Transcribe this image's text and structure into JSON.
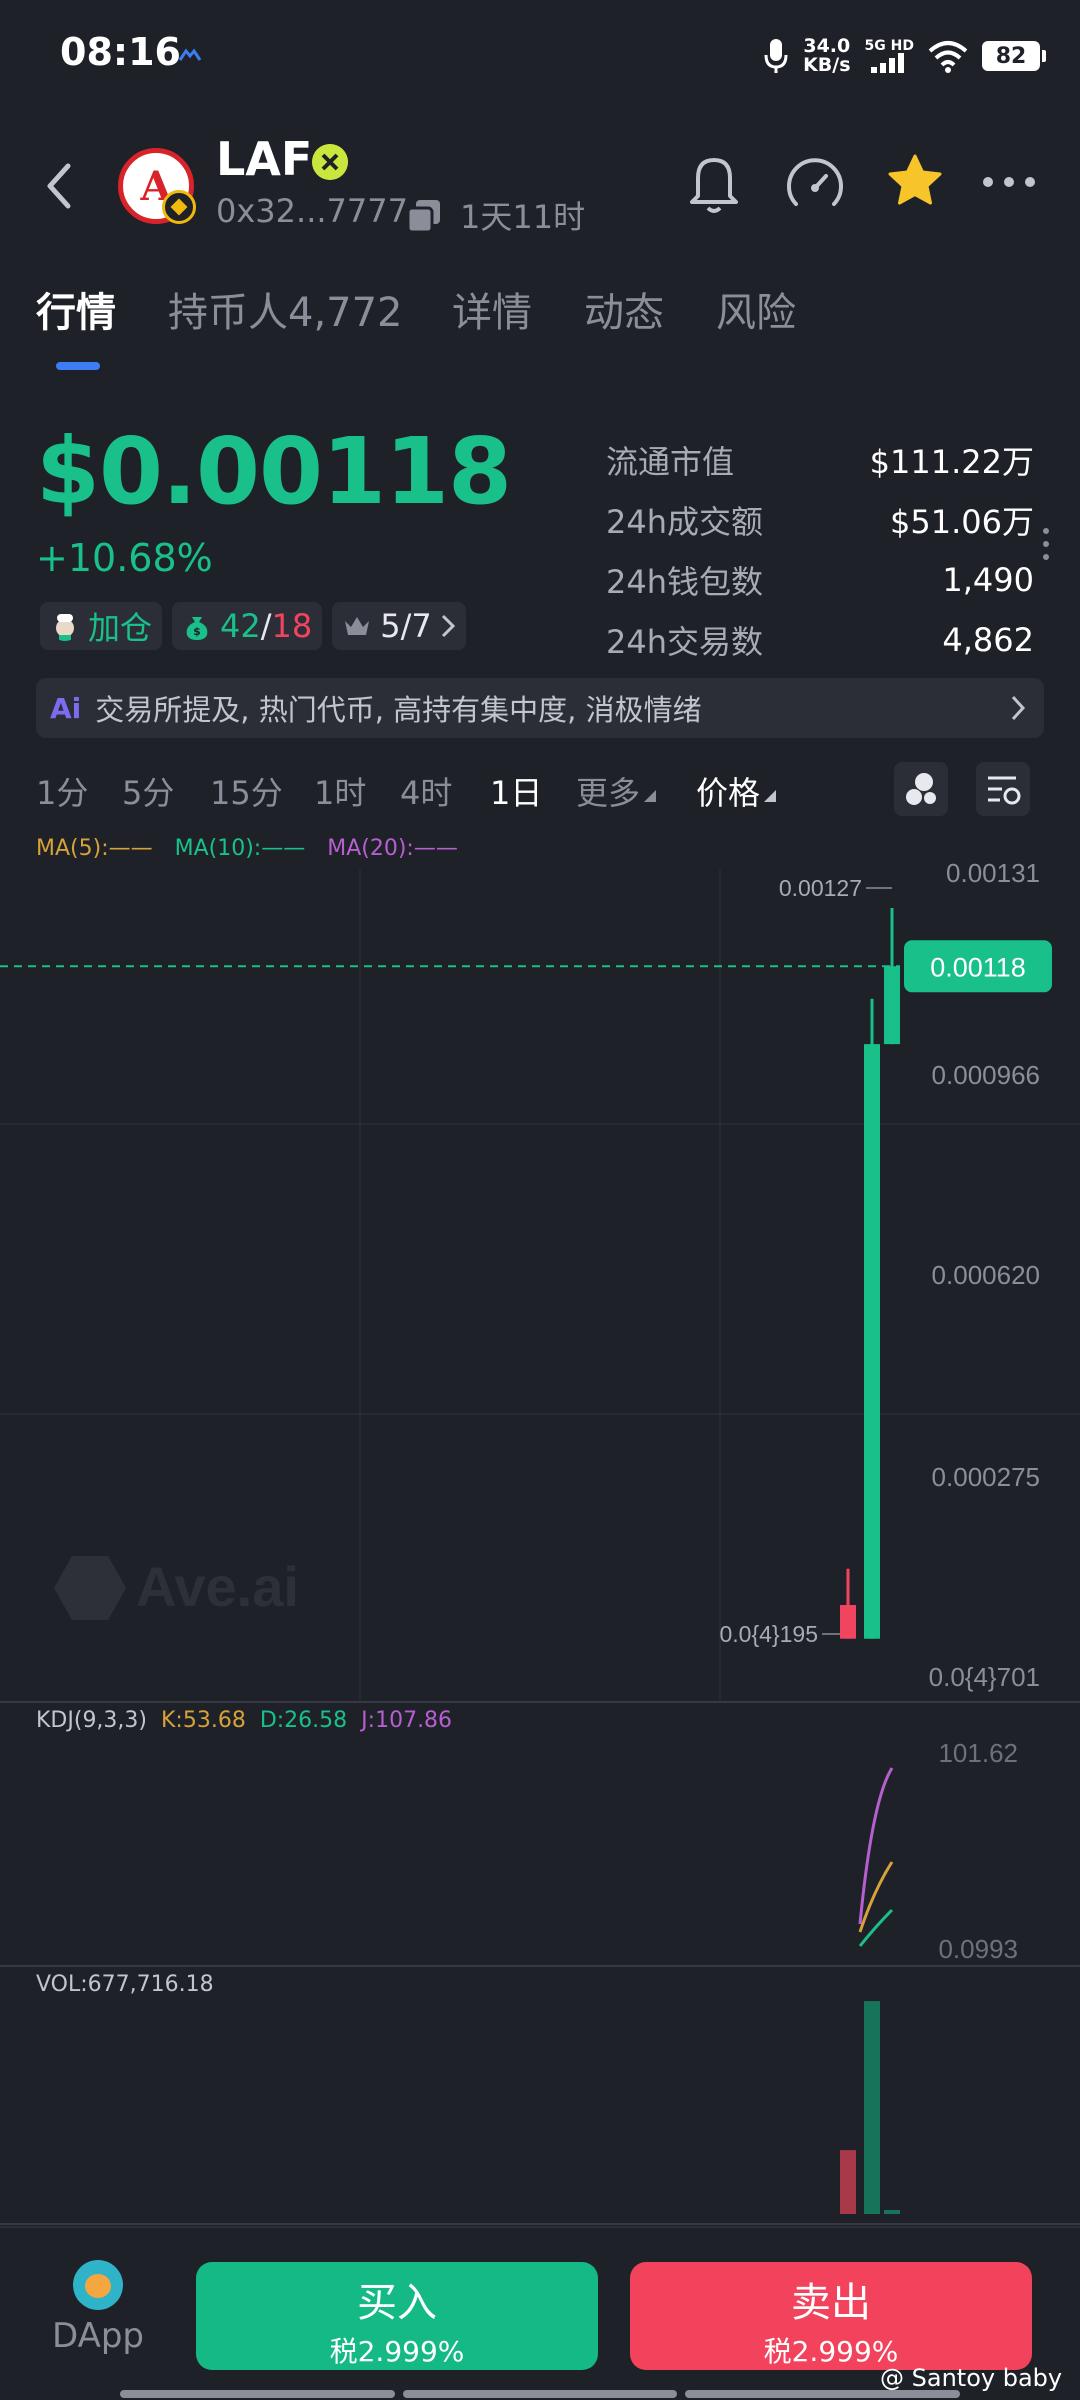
{
  "status_bar": {
    "time": "08:16",
    "net_speed_value": "34.0",
    "net_speed_unit": "KB/s",
    "network_label": "5G HD",
    "battery": "82"
  },
  "header": {
    "token_symbol": "LAF",
    "token_logo_letter": "A",
    "address": "0x32...7777",
    "age": "1天11时"
  },
  "tabs": [
    {
      "label": "行情"
    },
    {
      "label": "持币人4,772"
    },
    {
      "label": "详情"
    },
    {
      "label": "动态"
    },
    {
      "label": "风险"
    }
  ],
  "price": {
    "value": "$0.00118",
    "change": "+10.68%"
  },
  "chips": {
    "add_label": "加仓",
    "holders_green": "42",
    "holders_sep": "/",
    "holders_red": "18",
    "top_value": "5/7"
  },
  "stats": [
    {
      "label": "流通市值",
      "value": "$111.22万"
    },
    {
      "label": "24h成交额",
      "value": "$51.06万"
    },
    {
      "label": "24h钱包数",
      "value": "1,490"
    },
    {
      "label": "24h交易数",
      "value": "4,862"
    }
  ],
  "ai_bar": {
    "icon_text": "Ai",
    "text": "交易所提及, 热门代币, 高持有集中度, 消极情绪"
  },
  "timeframes": [
    {
      "label": "1分"
    },
    {
      "label": "5分"
    },
    {
      "label": "15分"
    },
    {
      "label": "1时"
    },
    {
      "label": "4时"
    },
    {
      "label": "1日"
    },
    {
      "label": "更多"
    },
    {
      "label": "价格"
    }
  ],
  "ma_legend": {
    "ma5": "MA(5):——",
    "ma10": "MA(10):——",
    "ma20": "MA(20):——"
  },
  "chart_data": {
    "type": "candlestick",
    "price_axis_labels": [
      "0.00131",
      "0.000966",
      "0.000620",
      "0.000275",
      "0.0{4}701"
    ],
    "current_price_label": "0.00118",
    "high_label": "0.00127",
    "low_label": "0.0{4}195",
    "candles": [
      {
        "open": 0.000195,
        "close": 0.000143,
        "high": 0.000251,
        "low": 0.000143,
        "direction": "down"
      },
      {
        "open": 0.000143,
        "close": 0.00106,
        "high": 0.00113,
        "low": 0.000143,
        "direction": "up"
      },
      {
        "open": 0.00106,
        "close": 0.00118,
        "high": 0.00127,
        "low": 0.00106,
        "direction": "up"
      }
    ],
    "watermark": "Ave.ai",
    "kdj": {
      "label": "KDJ(9,3,3)",
      "k": "K:53.68",
      "d": "D:26.58",
      "j": "J:107.86",
      "axis_max": "101.62",
      "axis_min": "0.0993"
    },
    "volume": {
      "label": "VOL:677,716.18",
      "bars": [
        {
          "value": 180000,
          "direction": "down"
        },
        {
          "value": 600000,
          "direction": "up"
        },
        {
          "value": 8000,
          "direction": "up"
        }
      ]
    },
    "colors": {
      "up": "#19c08a",
      "down": "#f0445f",
      "ma5": "#d6a23a",
      "ma10": "#19c08a",
      "ma20": "#b65fd0"
    }
  },
  "bottom_bar": {
    "dapp_label": "DApp",
    "buy_label": "买入",
    "buy_tax": "税2.999%",
    "sell_label": "卖出",
    "sell_tax": "税2.999%",
    "watermark": "@ Santoy baby"
  }
}
